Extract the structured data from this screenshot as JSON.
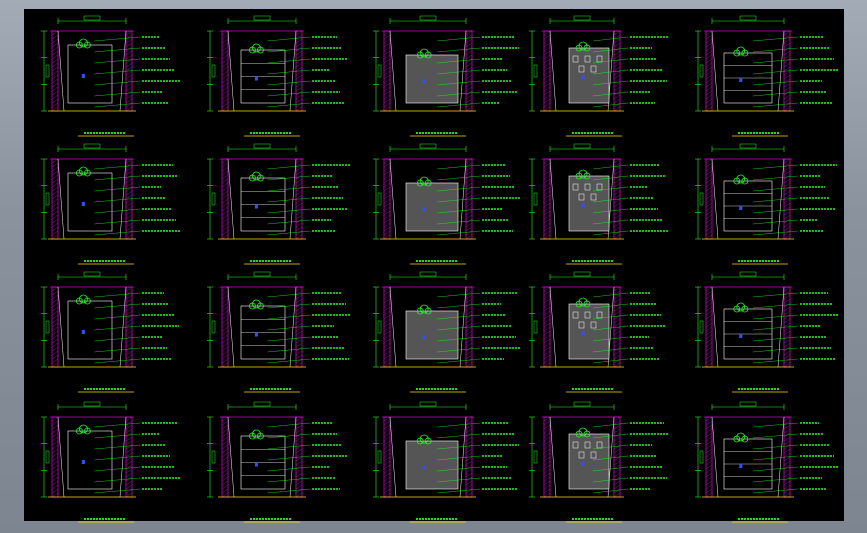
{
  "window": {
    "title": ""
  },
  "colors": {
    "background": "#000000",
    "wall_hatch": "#d000d0",
    "lines": "#ffffff",
    "dimension": "#19ff19",
    "annotation": "#19ff19",
    "title_underline": "#ffdd00",
    "plants": "#19ff19",
    "fixtures": "#3050ff"
  },
  "drawing": {
    "rows": 4,
    "cols": 5,
    "elevations": [
      {
        "title": ""
      },
      {
        "title": ""
      },
      {
        "title": ""
      },
      {
        "title": ""
      },
      {
        "title": ""
      },
      {
        "title": ""
      },
      {
        "title": ""
      },
      {
        "title": ""
      },
      {
        "title": ""
      },
      {
        "title": ""
      },
      {
        "title": ""
      },
      {
        "title": ""
      },
      {
        "title": ""
      },
      {
        "title": ""
      },
      {
        "title": ""
      },
      {
        "title": ""
      },
      {
        "title": ""
      },
      {
        "title": ""
      },
      {
        "title": ""
      },
      {
        "title": ""
      }
    ]
  }
}
